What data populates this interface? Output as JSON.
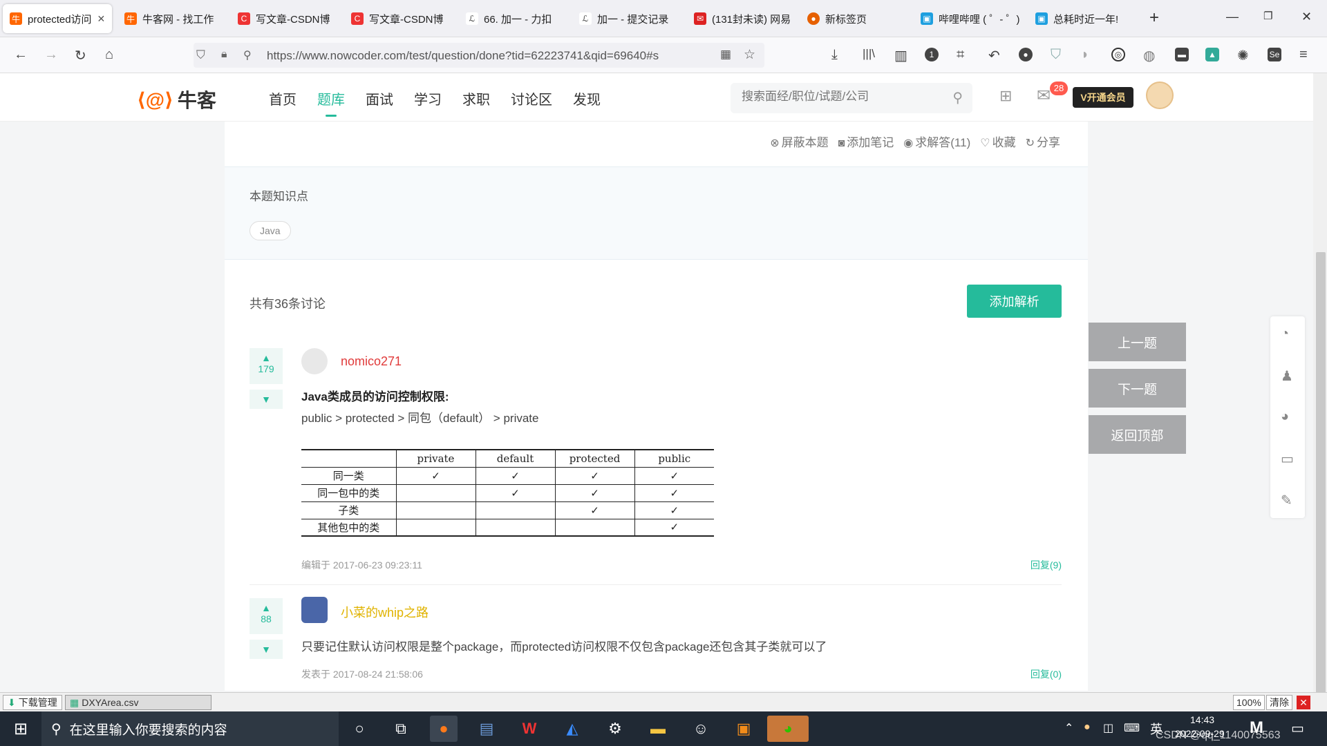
{
  "browser": {
    "tabs": [
      {
        "label": "protected访问",
        "active": true,
        "icon": "nowcoder-icon",
        "color": "#f60"
      },
      {
        "label": "牛客网 - 找工作",
        "icon": "nowcoder-icon",
        "color": "#f60"
      },
      {
        "label": "写文章-CSDN博",
        "icon": "csdn-icon",
        "color": "#e33"
      },
      {
        "label": "写文章-CSDN博",
        "icon": "csdn-icon",
        "color": "#e33"
      },
      {
        "label": "66. 加一 - 力扣",
        "icon": "leetcode-icon",
        "color": "#333"
      },
      {
        "label": "加一 - 提交记录",
        "icon": "leetcode-icon",
        "color": "#333"
      },
      {
        "label": "(131封未读) 网易",
        "icon": "mail-icon",
        "color": "#d22"
      },
      {
        "label": "新标签页",
        "icon": "firefox-icon",
        "color": "#e66000"
      },
      {
        "label": "哔哩哔哩 ( ゜- ゜)",
        "icon": "bilibili-icon",
        "color": "#1e9fdf"
      },
      {
        "label": "总耗时近一年!",
        "icon": "bilibili-icon",
        "color": "#1e9fdf"
      }
    ],
    "new_tab": "+",
    "url": "https://www.nowcoder.com/test/question/done?tid=62223741&qid=69640#s"
  },
  "site": {
    "logo_text": "牛客",
    "menu": [
      "首页",
      "题库",
      "面试",
      "学习",
      "求职",
      "讨论区",
      "发现"
    ],
    "active_menu": "题库",
    "search_placeholder": "搜索面经/职位/试题/公司",
    "mail_badge": "28",
    "vip_label": "V开通会员"
  },
  "question_actions": [
    "屏蔽本题",
    "添加笔记",
    "求解答(11)",
    "收藏",
    "分享"
  ],
  "knowledge": {
    "title": "本题知识点",
    "tags": [
      "Java"
    ]
  },
  "discussion": {
    "count_text": "共有36条讨论",
    "add_button": "添加解析",
    "comments": [
      {
        "votes": "179",
        "user": "nomico271",
        "user_color": "#e03a3a",
        "title": "Java类成员的访问控制权限:",
        "text": "public > protected > 同包（default） > private",
        "table": {
          "headers": [
            "",
            "private",
            "default",
            "protected",
            "public"
          ],
          "rows": [
            [
              "同一类",
              "✓",
              "✓",
              "✓",
              "✓"
            ],
            [
              "同一包中的类",
              "",
              "✓",
              "✓",
              "✓"
            ],
            [
              "子类",
              "",
              "",
              "✓",
              "✓"
            ],
            [
              "其他包中的类",
              "",
              "",
              "",
              "✓"
            ]
          ]
        },
        "meta": "编辑于 2017-06-23 09:23:11",
        "reply": "回复(9)"
      },
      {
        "votes": "88",
        "user": "小菜的whip之路",
        "user_color": "#e0b300",
        "text": "只要记住默认访问权限是整个package，而protected访问权限不仅包含package还包含其子类就可以了",
        "meta": "发表于 2017-08-24 21:58:06",
        "reply": "回复(0)"
      }
    ]
  },
  "side_nav": [
    "上一题",
    "下一题",
    "返回顶部"
  ],
  "download_bar": {
    "label": "下载管理",
    "file": "DXYArea.csv",
    "zoom": "100%",
    "clear": "清除"
  },
  "taskbar": {
    "search_placeholder": "在这里输入你要搜索的内容",
    "ime": "英",
    "time": "14:43",
    "date": "2022-09-29",
    "watermark": "CSDN @qq_1140075563"
  }
}
